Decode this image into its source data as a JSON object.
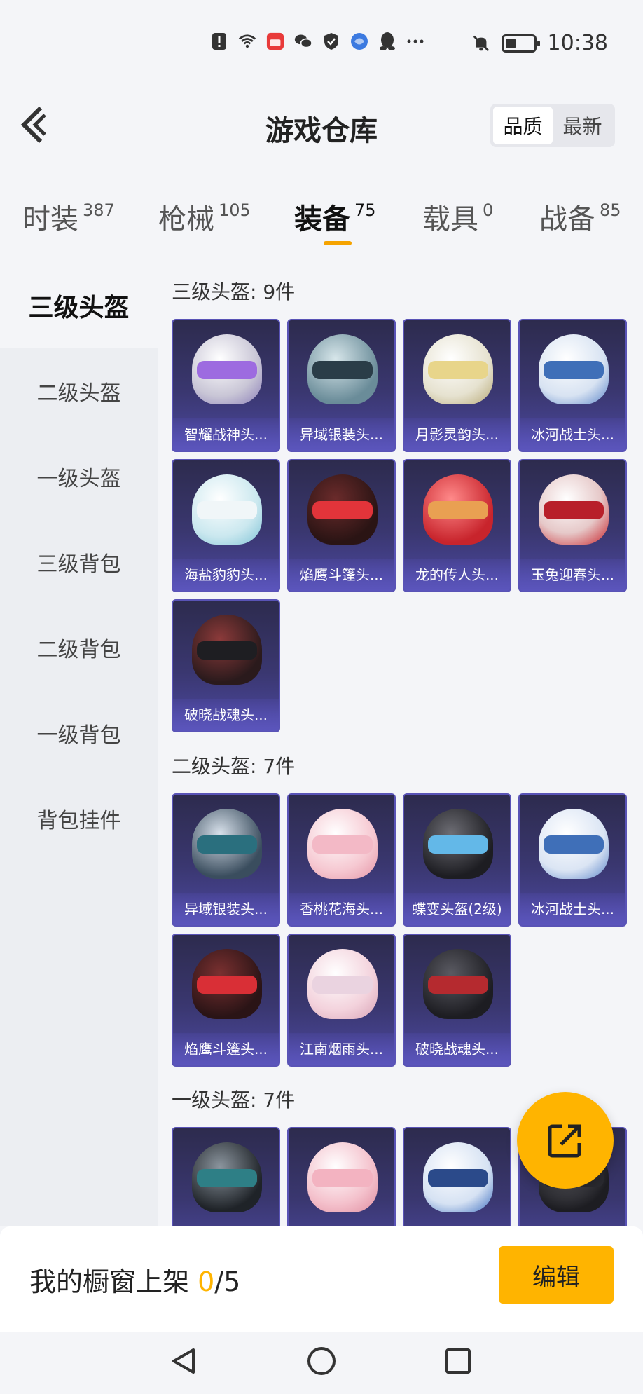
{
  "status_bar": {
    "time": "10:38",
    "icons": [
      "alert-icon",
      "wifi-icon",
      "huawei-app-icon",
      "wechat-icon",
      "shield-icon",
      "browser-icon",
      "qq-icon",
      "more-dots-icon",
      "mute-bell-icon",
      "battery-icon"
    ]
  },
  "header": {
    "title": "游戏仓库",
    "sort_options": [
      "品质",
      "最新"
    ]
  },
  "tabs": [
    {
      "label": "时装",
      "count": "387"
    },
    {
      "label": "枪械",
      "count": "105"
    },
    {
      "label": "装备",
      "count": "75"
    },
    {
      "label": "载具",
      "count": "0"
    },
    {
      "label": "战备",
      "count": "85"
    }
  ],
  "sidebar": {
    "items": [
      "三级头盔",
      "二级头盔",
      "一级头盔",
      "三级背包",
      "二级背包",
      "一级背包",
      "背包挂件"
    ]
  },
  "sections": [
    {
      "title": "三级头盔: 9件",
      "items": [
        "智耀战神头...",
        "异域银装头...",
        "月影灵韵头...",
        "冰河战士头...",
        "海盐豹豹头...",
        "焰鹰斗篷头...",
        "龙的传人头...",
        "玉兔迎春头...",
        "破晓战魂头..."
      ]
    },
    {
      "title": "二级头盔: 7件",
      "items": [
        "异域银装头...",
        "香桃花海头...",
        "蝶变头盔(2级)",
        "冰河战士头...",
        "焰鹰斗篷头...",
        "江南烟雨头...",
        "破晓战魂头..."
      ]
    },
    {
      "title": "一级头盔: 7件",
      "items": [
        "",
        "",
        "",
        ""
      ]
    }
  ],
  "bottom": {
    "label": "我的橱窗上架 ",
    "count": "0",
    "total": "/5",
    "edit_label": "编辑"
  },
  "colors": {
    "accent": "#ffb400",
    "card_bg": "#3a3770",
    "card_border": "#5953b6"
  }
}
